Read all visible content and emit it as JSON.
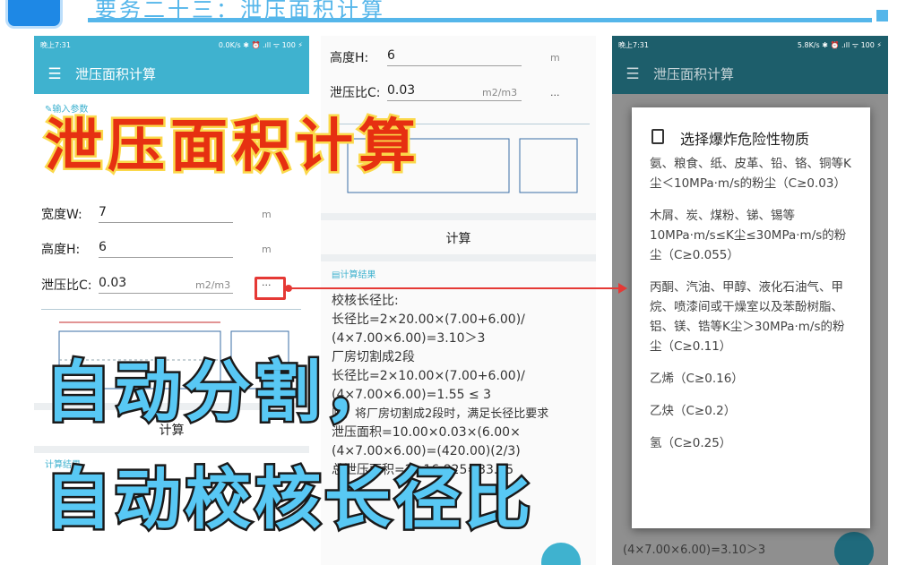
{
  "slide": {
    "title": "要务二十三：泄压面积计算"
  },
  "phone_left": {
    "status_time": "晚上7:31",
    "status_right": "0.0K/s ✱ ⏰ .ıll ᯤ 100 ⚡",
    "app_title": "泄压面积计算",
    "section_input": "✎输入参数",
    "width_label": "宽度W:",
    "width_value": "7",
    "width_unit": "m",
    "height_label": "高度H:",
    "height_value": "6",
    "height_unit": "m",
    "ratio_label": "泄压比C:",
    "ratio_value": "0.03",
    "ratio_unit": "m2/m3",
    "more_label": "···",
    "calc_label": "计算",
    "result_partial": "计算结果"
  },
  "phone_middle": {
    "height_label": "高度H:",
    "height_value": "6",
    "height_unit": "m",
    "ratio_label": "泄压比C:",
    "ratio_value": "0.03",
    "ratio_unit": "m2/m3",
    "more_label": "...",
    "calc_label": "计算",
    "result_section": "▤计算结果",
    "result_lines": [
      "校核长径比:",
      "长径比=2×20.00×(7.00+6.00)/",
      "(4×7.00×6.00)=3.10＞3",
      "厂房切割成2段",
      "长径比=2×10.00×(7.00+6.00)/",
      "(4×7.00×6.00)=1.55 ≤ 3",
      "则，将厂房切割成2段时，满足长径比要求",
      "泄压面积=10.00×0.03×(6.00×",
      "(4×7.00×6.00)=(420.00)(2/3)",
      "总泄压面积=2×16.825=33.65"
    ]
  },
  "phone_right": {
    "status_time": "晚上7:31",
    "status_right": "5.8K/s ✱ ⏰ .ıll ᯤ 100 ⚡",
    "app_title": "泄压面积计算",
    "behind_line": "(4×7.00×6.00)=3.10＞3",
    "dialog_title": "选择爆炸危险性物质",
    "options": [
      "氨、粮食、纸、皮革、铅、铬、铜等K尘＜10MPa·m/s的粉尘（C≥0.03）",
      "木屑、炭、煤粉、锑、锡等10MPa·m/s≤K尘≤30MPa·m/s的粉尘（C≥0.055）",
      "丙酮、汽油、甲醇、液化石油气、甲烷、喷漆间或干燥室以及苯酚树脂、铝、镁、锆等K尘＞30MPa·m/s的粉尘（C≥0.11）",
      "乙烯（C≥0.16）",
      "乙炔（C≥0.2）",
      "氢（C≥0.25）"
    ]
  },
  "overlay": {
    "title": "泄压面积计算",
    "subtitle_line1": "自动分割，",
    "subtitle_line2": "自动校核长径比"
  },
  "colors": {
    "accent": "#3fb2cf",
    "overlay_red": "#e63011",
    "overlay_blue": "#58c8f4",
    "arrow_red": "#e53935"
  }
}
